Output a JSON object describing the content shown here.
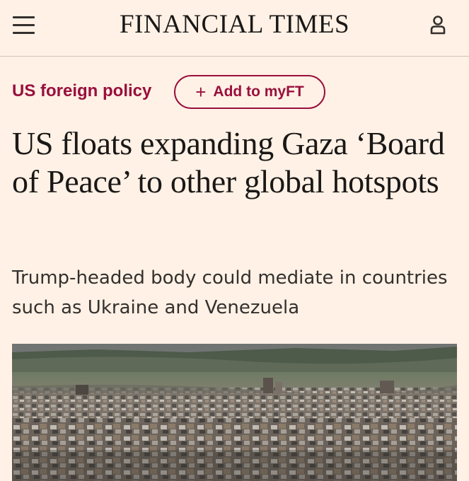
{
  "header": {
    "masthead": "FINANCIAL TIMES",
    "menu_icon": "hamburger-menu-icon",
    "account_icon": "user-account-icon"
  },
  "article": {
    "topic": "US foreign policy",
    "add_myft_label": "Add to myFT",
    "add_myft_icon": "plus-icon",
    "headline": "US floats expanding Gaza ‘Board of Peace’ to other global hotspots",
    "standfirst": "Trump-headed body could mediate in countries such as Ukraine and Venezuela"
  },
  "colors": {
    "background": "#fff1e5",
    "accent": "#990f3d",
    "text": "#1a1817"
  }
}
